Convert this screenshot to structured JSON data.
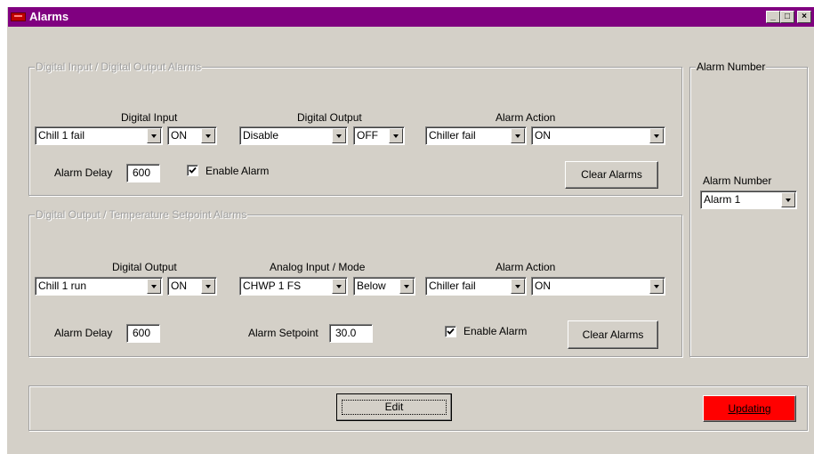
{
  "window": {
    "title": "Alarms",
    "controls": [
      "_",
      "□",
      "×"
    ]
  },
  "digital_group": {
    "legend": "Digital Input / Digital Output Alarms",
    "digital_input_label": "Digital Input",
    "digital_output_label": "Digital Output",
    "alarm_action_label": "Alarm Action",
    "digital_input_value": "Chill 1 fail",
    "digital_input_state": "ON",
    "digital_output_value": "Disable",
    "digital_output_state": "OFF",
    "alarm_action_value": "Chiller fail",
    "alarm_action_state": "ON",
    "alarm_delay_label": "Alarm Delay",
    "alarm_delay_value": "600",
    "enable_alarm_label": "Enable Alarm",
    "enable_alarm_checked": true,
    "clear_alarms_label": "Clear Alarms"
  },
  "temp_group": {
    "legend": "Digital Output / Temperature Setpoint Alarms",
    "digital_output_label": "Digital Output",
    "analog_input_label": "Analog Input / Mode",
    "alarm_action_label": "Alarm Action",
    "digital_output_value": "Chill 1 run",
    "digital_output_state": "ON",
    "analog_input_value": "CHWP 1 FS",
    "mode_value": "Below",
    "alarm_action_value": "Chiller fail",
    "alarm_action_state": "ON",
    "alarm_delay_label": "Alarm Delay",
    "alarm_delay_value": "600",
    "alarm_setpoint_label": "Alarm Setpoint",
    "alarm_setpoint_value": "30.0",
    "enable_alarm_label": "Enable Alarm",
    "enable_alarm_checked": true,
    "clear_alarms_label": "Clear Alarms"
  },
  "alarm_number_group": {
    "legend": "Alarm Number",
    "label": "Alarm Number",
    "value": "Alarm 1"
  },
  "bottom": {
    "edit_label": "Edit",
    "updating_label": "Updating",
    "updating_color": "#ff0000"
  }
}
